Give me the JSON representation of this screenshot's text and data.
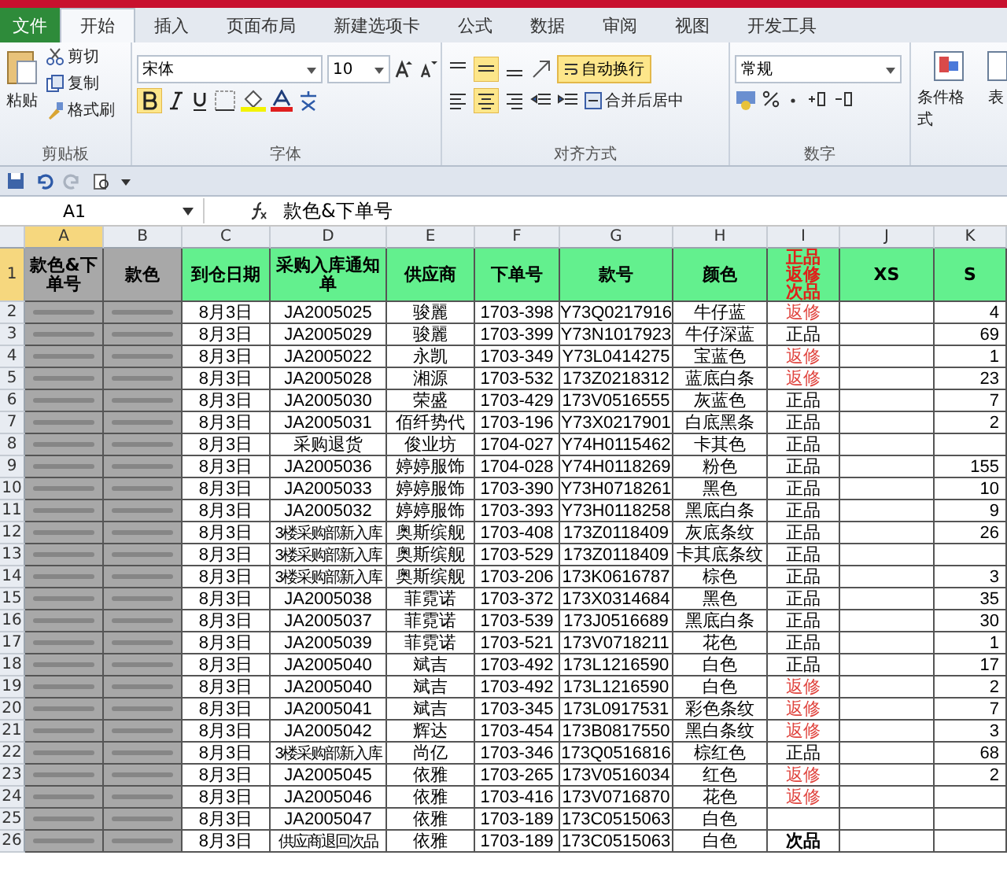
{
  "ribbon_tabs": [
    {
      "label": "文件",
      "kind": "file",
      "selected": false
    },
    {
      "label": "开始",
      "kind": "tab",
      "selected": true
    },
    {
      "label": "插入",
      "kind": "tab",
      "selected": false
    },
    {
      "label": "页面布局",
      "kind": "tab",
      "selected": false
    },
    {
      "label": "新建选项卡",
      "kind": "tab",
      "selected": false
    },
    {
      "label": "公式",
      "kind": "tab",
      "selected": false
    },
    {
      "label": "数据",
      "kind": "tab",
      "selected": false
    },
    {
      "label": "审阅",
      "kind": "tab",
      "selected": false
    },
    {
      "label": "视图",
      "kind": "tab",
      "selected": false
    },
    {
      "label": "开发工具",
      "kind": "tab",
      "selected": false
    }
  ],
  "clipboard": {
    "paste": "粘贴",
    "cut": "剪切",
    "copy": "复制",
    "format_painter": "格式刷",
    "label": "剪贴板"
  },
  "font": {
    "name": "宋体",
    "size": "10",
    "label": "字体"
  },
  "alignment": {
    "wrap_text": "自动换行",
    "merge_center": "合并后居中",
    "label": "对齐方式"
  },
  "number": {
    "format": "常规",
    "label": "数字"
  },
  "styles": {
    "conditional_format": "条件格式",
    "table_format": "表"
  },
  "name_box": "A1",
  "formula": "款色&下单号",
  "columns": [
    "A",
    "B",
    "C",
    "D",
    "E",
    "F",
    "G",
    "H",
    "I",
    "J",
    "K"
  ],
  "header": {
    "row": "1",
    "cells": [
      {
        "text": "款色&下单号",
        "kind": "grey"
      },
      {
        "text": "款色",
        "kind": "grey"
      },
      {
        "text": "到仓日期",
        "kind": "green"
      },
      {
        "text": "采购入库通知单",
        "kind": "green"
      },
      {
        "text": "供应商",
        "kind": "green"
      },
      {
        "text": "下单号",
        "kind": "green"
      },
      {
        "text": "款号",
        "kind": "green"
      },
      {
        "text": "颜色",
        "kind": "green"
      },
      {
        "text": "正品返修次品",
        "kind": "status"
      },
      {
        "text": "XS",
        "kind": "green"
      },
      {
        "text": "S",
        "kind": "green"
      }
    ]
  },
  "rows": [
    {
      "row": "2",
      "date": "8月3日",
      "notice": {
        "text": "JA2005025",
        "kind": "code"
      },
      "supplier": "骏麗",
      "order": "1703-398",
      "style": "Y73Q0217916",
      "color_name": "牛仔蓝",
      "status": {
        "text": "返修",
        "kind": "repair"
      },
      "s": "4"
    },
    {
      "row": "3",
      "date": "8月3日",
      "notice": {
        "text": "JA2005029",
        "kind": "code"
      },
      "supplier": "骏麗",
      "order": "1703-399",
      "style": "Y73N1017923",
      "color_name": "牛仔深蓝",
      "status": {
        "text": "正品",
        "kind": "ok"
      },
      "s": "69"
    },
    {
      "row": "4",
      "date": "8月3日",
      "notice": {
        "text": "JA2005022",
        "kind": "code"
      },
      "supplier": "永凯",
      "order": "1703-349",
      "style": "Y73L0414275",
      "color_name": "宝蓝色",
      "status": {
        "text": "返修",
        "kind": "repair"
      },
      "s": "1"
    },
    {
      "row": "5",
      "date": "8月3日",
      "notice": {
        "text": "JA2005028",
        "kind": "code"
      },
      "supplier": "湘源",
      "order": "1703-532",
      "style": "173Z0218312",
      "color_name": "蓝底白条",
      "status": {
        "text": "返修",
        "kind": "repair"
      },
      "s": "23"
    },
    {
      "row": "6",
      "date": "8月3日",
      "notice": {
        "text": "JA2005030",
        "kind": "code"
      },
      "supplier": "荣盛",
      "order": "1703-429",
      "style": "173V0516555",
      "color_name": "灰蓝色",
      "status": {
        "text": "正品",
        "kind": "ok"
      },
      "s": "7"
    },
    {
      "row": "7",
      "date": "8月3日",
      "notice": {
        "text": "JA2005031",
        "kind": "code"
      },
      "supplier": "佰纤势代",
      "order": "1703-196",
      "style": "Y73X0217901",
      "color_name": "白底黑条",
      "status": {
        "text": "正品",
        "kind": "ok"
      },
      "s": "2"
    },
    {
      "row": "8",
      "date": "8月3日",
      "notice": {
        "text": "采购退货",
        "kind": "code"
      },
      "supplier": "俊业坊",
      "order": "1704-027",
      "style": "Y74H0115462",
      "color_name": "卡其色",
      "status": {
        "text": "正品",
        "kind": "ok"
      }
    },
    {
      "row": "9",
      "date": "8月3日",
      "notice": {
        "text": "JA2005036",
        "kind": "code"
      },
      "supplier": "婷婷服饰",
      "order": "1704-028",
      "style": "Y74H0118269",
      "color_name": "粉色",
      "status": {
        "text": "正品",
        "kind": "ok"
      },
      "s": "155"
    },
    {
      "row": "10",
      "date": "8月3日",
      "notice": {
        "text": "JA2005033",
        "kind": "code"
      },
      "supplier": "婷婷服饰",
      "order": "1703-390",
      "style": "Y73H0718261",
      "color_name": "黑色",
      "status": {
        "text": "正品",
        "kind": "ok"
      },
      "s": "10"
    },
    {
      "row": "11",
      "date": "8月3日",
      "notice": {
        "text": "JA2005032",
        "kind": "code"
      },
      "supplier": "婷婷服饰",
      "order": "1703-393",
      "style": "Y73H0118258",
      "color_name": "黑底白条",
      "status": {
        "text": "正品",
        "kind": "ok"
      },
      "s": "9"
    },
    {
      "row": "12",
      "date": "8月3日",
      "notice": {
        "text": "3楼采购部新入库",
        "kind": "note"
      },
      "supplier": "奥斯缤舰",
      "order": "1703-408",
      "style": "173Z0118409",
      "color_name": "灰底条纹",
      "status": {
        "text": "正品",
        "kind": "ok"
      },
      "s": "26"
    },
    {
      "row": "13",
      "date": "8月3日",
      "notice": {
        "text": "3楼采购部新入库",
        "kind": "note"
      },
      "supplier": "奥斯缤舰",
      "order": "1703-529",
      "style": "173Z0118409",
      "color_name": "卡其底条纹",
      "status": {
        "text": "正品",
        "kind": "ok"
      }
    },
    {
      "row": "14",
      "date": "8月3日",
      "notice": {
        "text": "3楼采购部新入库",
        "kind": "note"
      },
      "supplier": "奥斯缤舰",
      "order": "1703-206",
      "style": "173K0616787",
      "color_name": "棕色",
      "status": {
        "text": "正品",
        "kind": "ok"
      },
      "s": "3"
    },
    {
      "row": "15",
      "date": "8月3日",
      "notice": {
        "text": "JA2005038",
        "kind": "code"
      },
      "supplier": "菲霓诺",
      "order": "1703-372",
      "style": "173X0314684",
      "color_name": "黑色",
      "status": {
        "text": "正品",
        "kind": "ok"
      },
      "s": "35"
    },
    {
      "row": "16",
      "date": "8月3日",
      "notice": {
        "text": "JA2005037",
        "kind": "code"
      },
      "supplier": "菲霓诺",
      "order": "1703-539",
      "style": "173J0516689",
      "color_name": "黑底白条",
      "status": {
        "text": "正品",
        "kind": "ok"
      },
      "s": "30"
    },
    {
      "row": "17",
      "date": "8月3日",
      "notice": {
        "text": "JA2005039",
        "kind": "code"
      },
      "supplier": "菲霓诺",
      "order": "1703-521",
      "style": "173V0718211",
      "color_name": "花色",
      "status": {
        "text": "正品",
        "kind": "ok"
      },
      "s": "1"
    },
    {
      "row": "18",
      "date": "8月3日",
      "notice": {
        "text": "JA2005040",
        "kind": "code"
      },
      "supplier": "斌吉",
      "order": "1703-492",
      "style": "173L1216590",
      "color_name": "白色",
      "status": {
        "text": "正品",
        "kind": "ok"
      },
      "s": "17"
    },
    {
      "row": "19",
      "date": "8月3日",
      "notice": {
        "text": "JA2005040",
        "kind": "code"
      },
      "supplier": "斌吉",
      "order": "1703-492",
      "style": "173L1216590",
      "color_name": "白色",
      "status": {
        "text": "返修",
        "kind": "repair"
      },
      "s": "2"
    },
    {
      "row": "20",
      "date": "8月3日",
      "notice": {
        "text": "JA2005041",
        "kind": "code"
      },
      "supplier": "斌吉",
      "order": "1703-345",
      "style": "173L0917531",
      "color_name": "彩色条纹",
      "status": {
        "text": "返修",
        "kind": "repair"
      },
      "s": "7"
    },
    {
      "row": "21",
      "date": "8月3日",
      "notice": {
        "text": "JA2005042",
        "kind": "code"
      },
      "supplier": "辉达",
      "order": "1703-454",
      "style": "173B0817550",
      "color_name": "黑白条纹",
      "status": {
        "text": "返修",
        "kind": "repair"
      },
      "s": "3"
    },
    {
      "row": "22",
      "date": "8月3日",
      "notice": {
        "text": "3楼采购部新入库",
        "kind": "note"
      },
      "supplier": "尚亿",
      "order": "1703-346",
      "style": "173Q0516816",
      "color_name": "棕红色",
      "status": {
        "text": "正品",
        "kind": "ok"
      },
      "s": "68"
    },
    {
      "row": "23",
      "date": "8月3日",
      "notice": {
        "text": "JA2005045",
        "kind": "code"
      },
      "supplier": "依雅",
      "order": "1703-265",
      "style": "173V0516034",
      "color_name": "红色",
      "status": {
        "text": "返修",
        "kind": "repair"
      },
      "s": "2"
    },
    {
      "row": "24",
      "date": "8月3日",
      "notice": {
        "text": "JA2005046",
        "kind": "code"
      },
      "supplier": "依雅",
      "order": "1703-416",
      "style": "173V0716870",
      "color_name": "花色",
      "status": {
        "text": "返修",
        "kind": "repair"
      }
    },
    {
      "row": "25",
      "date": "8月3日",
      "notice": {
        "text": "JA2005047",
        "kind": "code"
      },
      "supplier": "依雅",
      "order": "1703-189",
      "style": "173C0515063",
      "color_name": "白色"
    },
    {
      "row": "26",
      "date": "8月3日",
      "notice": {
        "text": "供应商退回次品",
        "kind": "note"
      },
      "supplier": "依雅",
      "order": "1703-189",
      "style": "173C0515063",
      "color_name": "白色",
      "status": {
        "text": "次品",
        "kind": "defect"
      }
    }
  ]
}
